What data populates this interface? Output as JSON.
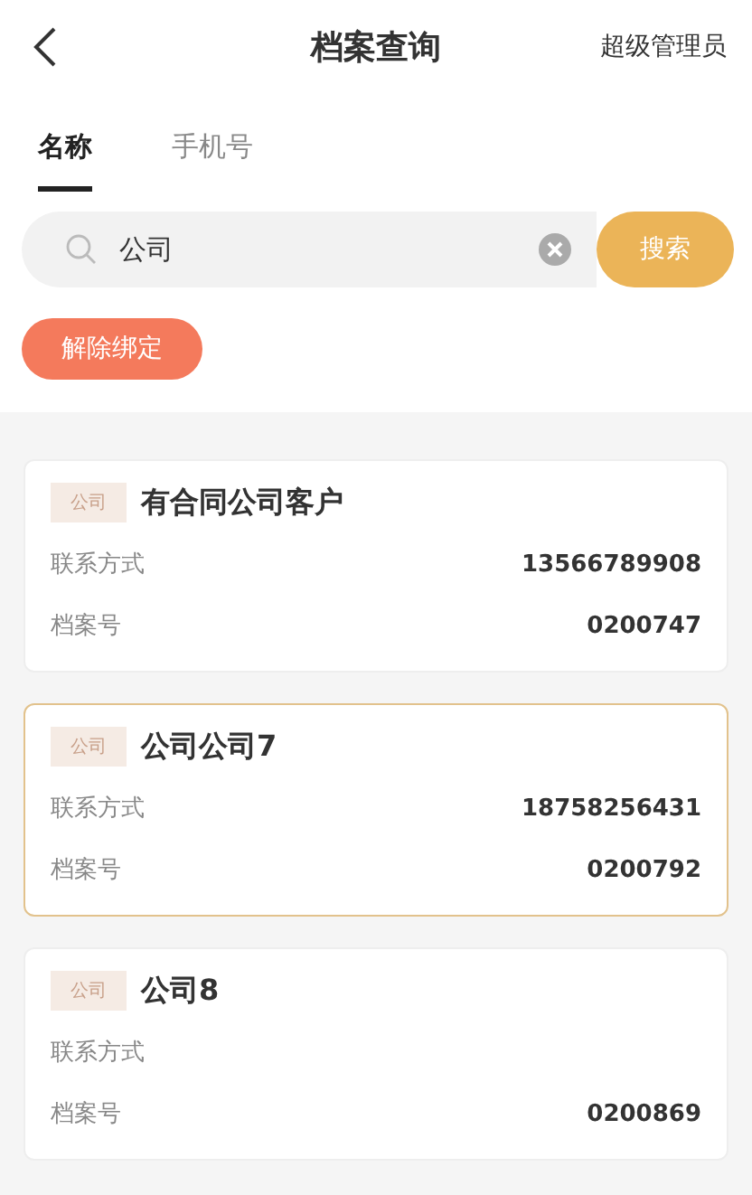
{
  "header": {
    "title": "档案查询",
    "user": "超级管理员"
  },
  "tabs": [
    {
      "label": "名称",
      "selected": true
    },
    {
      "label": "手机号",
      "selected": false
    }
  ],
  "search": {
    "value": "公司",
    "button": "搜索"
  },
  "unbind_button": "解除绑定",
  "records": [
    {
      "tag": "公司",
      "name": "有合同公司客户",
      "selected": false,
      "fields": [
        {
          "label": "联系方式",
          "value": "13566789908"
        },
        {
          "label": "档案号",
          "value": "0200747"
        }
      ]
    },
    {
      "tag": "公司",
      "name": "公司公司7",
      "selected": true,
      "fields": [
        {
          "label": "联系方式",
          "value": "18758256431"
        },
        {
          "label": "档案号",
          "value": "0200792"
        }
      ]
    },
    {
      "tag": "公司",
      "name": "公司8",
      "selected": false,
      "fields": [
        {
          "label": "联系方式"
        },
        {
          "label": "档案号",
          "value": "0200869"
        }
      ]
    }
  ]
}
